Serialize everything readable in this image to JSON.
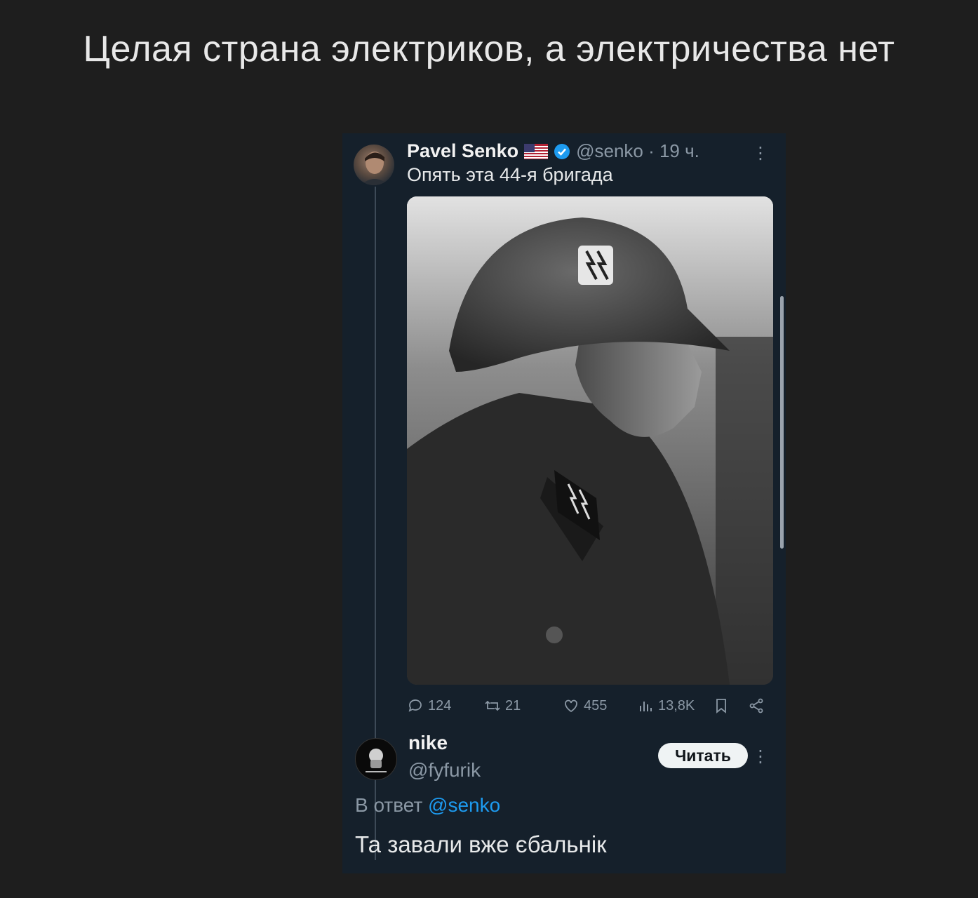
{
  "post": {
    "title": "Целая страна электриков, а электричества нет"
  },
  "tweet": {
    "author_name": "Pavel Senko",
    "handle_time": "@senko · 19 ч.",
    "text": "Опять эта 44-я бригада",
    "flag_icon": "us-flag-icon",
    "verified_icon": "verified-badge-icon",
    "image_alt": "photo",
    "actions": {
      "replies": "124",
      "retweets": "21",
      "likes": "455",
      "views": "13,8K"
    }
  },
  "reply": {
    "author_name": "nike",
    "handle": "@fyfurik",
    "follow_label": "Читать",
    "in_reply_prefix": "В ответ",
    "in_reply_mention": "@senko",
    "text": "Та завали вже єбальнік"
  },
  "colors": {
    "page_bg": "#1e1e1e",
    "tweet_bg": "#15202b",
    "accent": "#1d9bf0",
    "muted": "#8b98a5"
  }
}
